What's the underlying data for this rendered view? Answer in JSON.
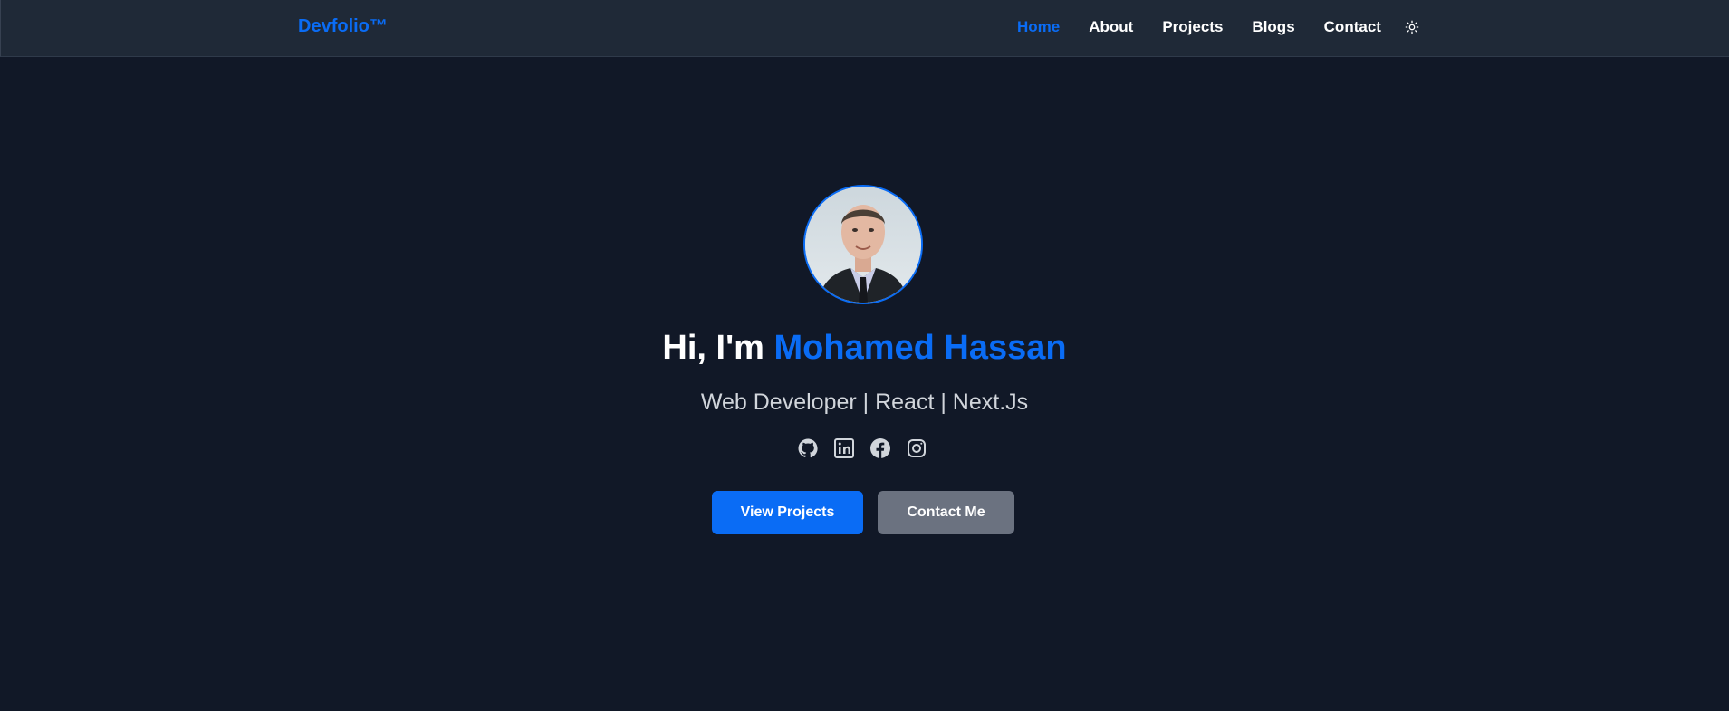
{
  "nav": {
    "brand": "Devfolio™",
    "links": [
      {
        "label": "Home",
        "active": true
      },
      {
        "label": "About",
        "active": false
      },
      {
        "label": "Projects",
        "active": false
      },
      {
        "label": "Blogs",
        "active": false
      },
      {
        "label": "Contact",
        "active": false
      }
    ],
    "theme_icon": "sun-icon"
  },
  "hero": {
    "greeting": "Hi, I'm",
    "name": "Mohamed Hassan",
    "subtitle": "Web Developer | React | Next.Js",
    "socials": [
      "github-icon",
      "linkedin-icon",
      "facebook-icon",
      "instagram-icon"
    ],
    "primary_button": "View Projects",
    "secondary_button": "Contact Me"
  },
  "colors": {
    "accent": "#0a6cf5",
    "background": "#111827",
    "navbar": "#1f2937",
    "secondary_button": "#6b7280"
  }
}
